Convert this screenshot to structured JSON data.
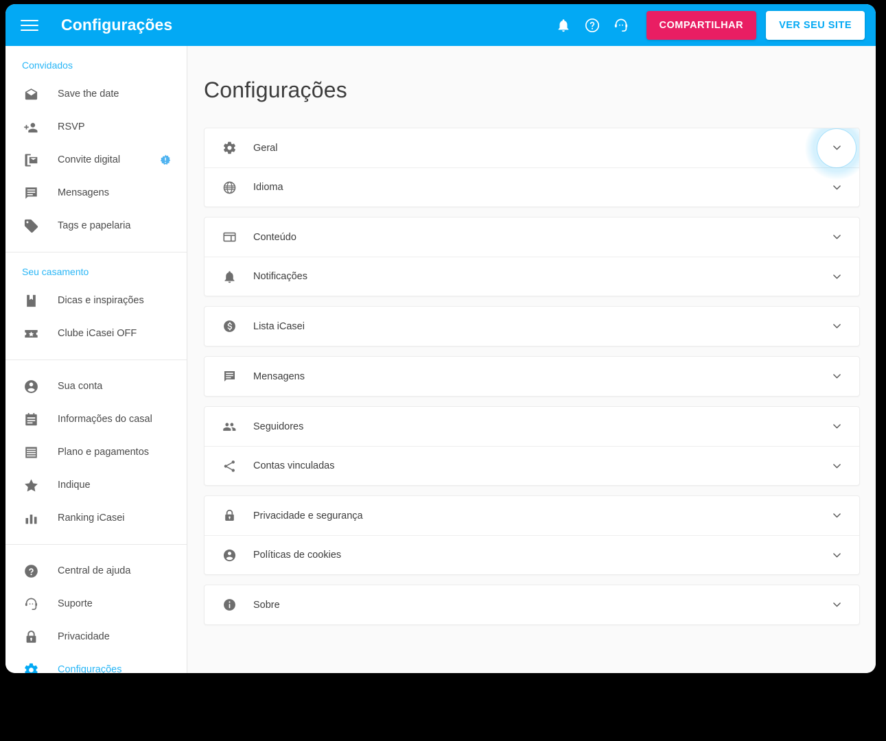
{
  "colors": {
    "brand_blue": "#03a9f4",
    "link_blue": "#29b6f6",
    "share_pink": "#e91e63",
    "page_bg": "#fafafa",
    "card_bg": "#ffffff",
    "text_dark": "#3c3c3c",
    "icon_grey": "#6e6e6e"
  },
  "topbar": {
    "menu_icon": "hamburger-icon",
    "title": "Configurações",
    "icons": [
      {
        "name": "notifications-bell-icon"
      },
      {
        "name": "help-circle-icon"
      },
      {
        "name": "support-agent-icon"
      }
    ],
    "share_label": "COMPARTILHAR",
    "site_label": "VER SEU SITE"
  },
  "sidebar": {
    "groups": [
      {
        "heading": "Convidados",
        "items": [
          {
            "icon": "mail-open-icon",
            "label": "Save the date",
            "active": false,
            "badge": null
          },
          {
            "icon": "person-add-icon",
            "label": "RSVP",
            "active": false,
            "badge": null
          },
          {
            "icon": "mobile-invite-icon",
            "label": "Convite digital",
            "active": false,
            "badge": "alert-badge-icon"
          },
          {
            "icon": "message-icon",
            "label": "Mensagens",
            "active": false,
            "badge": null
          },
          {
            "icon": "tag-icon",
            "label": "Tags e papelaria",
            "active": false,
            "badge": null
          }
        ]
      },
      {
        "heading": "Seu casamento",
        "items": [
          {
            "icon": "book-icon",
            "label": "Dicas e inspirações",
            "active": false,
            "badge": null
          },
          {
            "icon": "ticket-star-icon",
            "label": "Clube iCasei OFF",
            "active": false,
            "badge": null
          }
        ]
      },
      {
        "heading": null,
        "items": [
          {
            "icon": "account-circle-icon",
            "label": "Sua conta",
            "active": false,
            "badge": null
          },
          {
            "icon": "calendar-note-icon",
            "label": "Informações do casal",
            "active": false,
            "badge": null
          },
          {
            "icon": "payments-list-icon",
            "label": "Plano e pagamentos",
            "active": false,
            "badge": null
          },
          {
            "icon": "star-icon",
            "label": "Indique",
            "active": false,
            "badge": null
          },
          {
            "icon": "bar-chart-icon",
            "label": "Ranking iCasei",
            "active": false,
            "badge": null
          }
        ]
      },
      {
        "heading": null,
        "items": [
          {
            "icon": "help-circle-filled-icon",
            "label": "Central de ajuda",
            "active": false,
            "badge": null
          },
          {
            "icon": "support-agent-icon",
            "label": "Suporte",
            "active": false,
            "badge": null
          },
          {
            "icon": "lock-icon",
            "label": "Privacidade",
            "active": false,
            "badge": null
          },
          {
            "icon": "gear-icon",
            "label": "Configurações",
            "active": true,
            "badge": null
          }
        ]
      }
    ]
  },
  "main": {
    "title": "Configurações",
    "card_groups": [
      {
        "rows": [
          {
            "icon": "gear-icon",
            "label": "Geral",
            "chevron": "chevron-down-icon",
            "focused": true
          },
          {
            "icon": "globe-icon",
            "label": "Idioma",
            "chevron": "chevron-down-icon",
            "focused": false
          }
        ]
      },
      {
        "rows": [
          {
            "icon": "layout-content-icon",
            "label": "Conteúdo",
            "chevron": "chevron-down-icon",
            "focused": false
          },
          {
            "icon": "bell-icon",
            "label": "Notificações",
            "chevron": "chevron-down-icon",
            "focused": false
          }
        ]
      },
      {
        "rows": [
          {
            "icon": "money-circle-icon",
            "label": "Lista iCasei",
            "chevron": "chevron-down-icon",
            "focused": false
          }
        ]
      },
      {
        "rows": [
          {
            "icon": "message-icon",
            "label": "Mensagens",
            "chevron": "chevron-down-icon",
            "focused": false
          }
        ]
      },
      {
        "rows": [
          {
            "icon": "people-icon",
            "label": "Seguidores",
            "chevron": "chevron-down-icon",
            "focused": false
          },
          {
            "icon": "share-icon",
            "label": "Contas vinculadas",
            "chevron": "chevron-down-icon",
            "focused": false
          }
        ]
      },
      {
        "rows": [
          {
            "icon": "lock-icon",
            "label": "Privacidade e segurança",
            "chevron": "chevron-down-icon",
            "focused": false
          },
          {
            "icon": "account-circle-icon",
            "label": "Políticas de cookies",
            "chevron": "chevron-down-icon",
            "focused": false
          }
        ]
      },
      {
        "rows": [
          {
            "icon": "info-circle-icon",
            "label": "Sobre",
            "chevron": "chevron-down-icon",
            "focused": false
          }
        ]
      }
    ]
  }
}
